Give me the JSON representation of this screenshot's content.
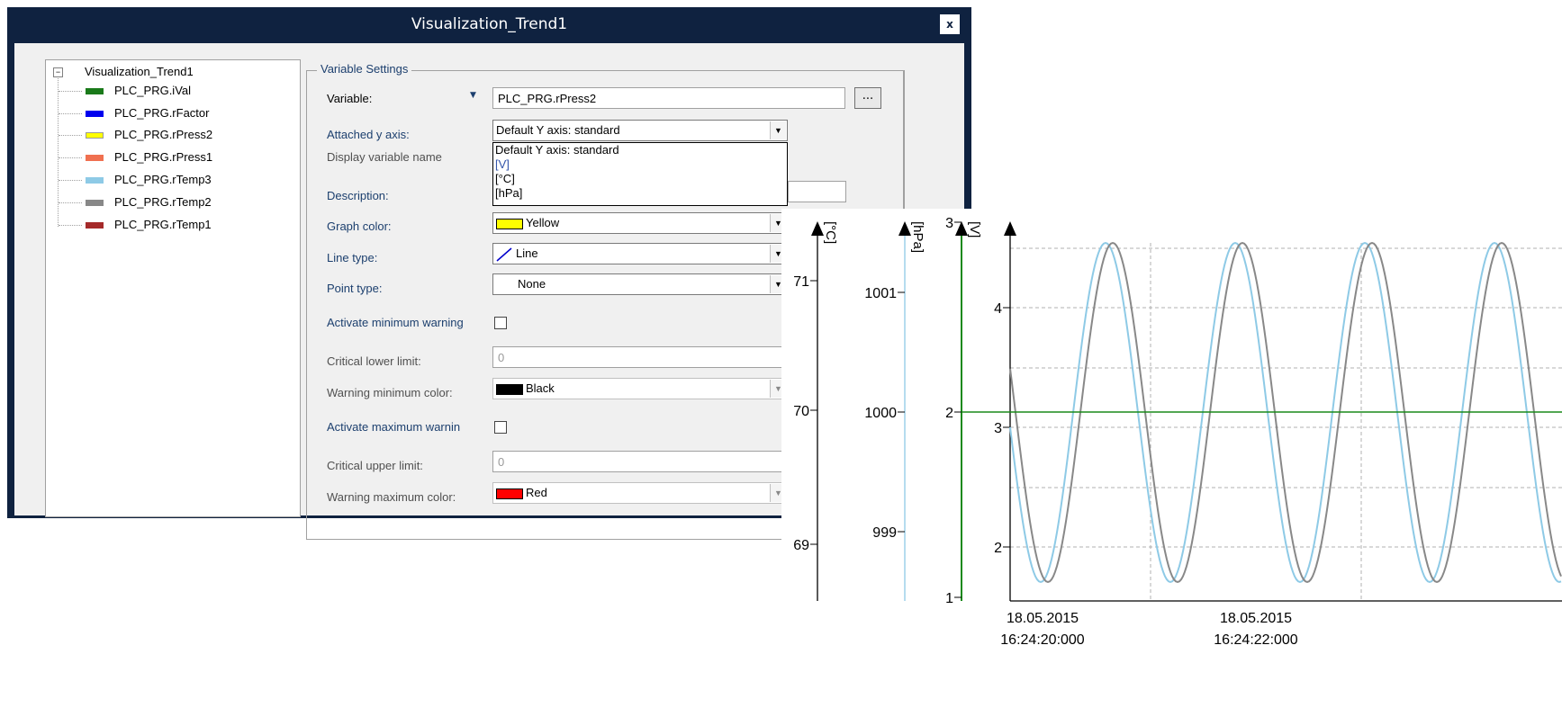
{
  "dialog": {
    "title": "Visualization_Trend1",
    "close_label": "x"
  },
  "tree": {
    "root": "Visualization_Trend1",
    "expander": "⊟",
    "items": [
      {
        "label": "PLC_PRG.iVal",
        "color": "#1a7a1a"
      },
      {
        "label": "PLC_PRG.rFactor",
        "color": "#0000ee"
      },
      {
        "label": "PLC_PRG.rPress2",
        "color": "#ffff00"
      },
      {
        "label": "PLC_PRG.rPress1",
        "color": "#f07050"
      },
      {
        "label": "PLC_PRG.rTemp3",
        "color": "#8ecae6"
      },
      {
        "label": "PLC_PRG.rTemp2",
        "color": "#888888"
      },
      {
        "label": "PLC_PRG.rTemp1",
        "color": "#a52a2a"
      }
    ]
  },
  "settings": {
    "group_title": "Variable Settings",
    "variable_label": "Variable:",
    "variable_value": "PLC_PRG.rPress2",
    "browse_label": "...",
    "y_axis_label": "Attached y axis:",
    "y_axis_value": "Default Y axis: standard",
    "y_axis_options": [
      "Default Y axis: standard",
      "[V]",
      "[°C]",
      "[hPa]"
    ],
    "display_name_label": "Display variable name",
    "description_label": "Description:",
    "graph_color_label": "Graph color:",
    "graph_color_value": "Yellow",
    "graph_color_swatch": "#ffff00",
    "line_type_label": "Line type:",
    "line_type_value": "Line",
    "point_type_label": "Point type:",
    "point_type_value": "None",
    "min_warning_label": "Activate minimum warning",
    "critical_lower_label": "Critical lower limit:",
    "critical_lower_value": "0",
    "warn_min_color_label": "Warning minimum color:",
    "warn_min_color_value": "Black",
    "warn_min_color_swatch": "#000000",
    "max_warning_label": "Activate maximum warnin",
    "critical_upper_label": "Critical upper limit:",
    "critical_upper_value": "0",
    "warn_max_color_label": "Warning maximum color:",
    "warn_max_color_value": "Red",
    "warn_max_color_swatch": "#ff0000"
  },
  "chart_data": {
    "type": "line",
    "y_axes": [
      {
        "label": "[°C]",
        "ticks": [
          "71",
          "70",
          "69"
        ],
        "color": "#000000"
      },
      {
        "label": "[hPa]",
        "ticks": [
          "1001",
          "1000",
          "999"
        ],
        "color": "#8ecae6"
      },
      {
        "label": "[V]",
        "ticks": [
          "3",
          "2",
          "1"
        ],
        "color": "#1a8a1a"
      },
      {
        "label": "",
        "ticks": [
          "4",
          "3",
          "2"
        ],
        "color": "#000000"
      }
    ],
    "x_ticks": [
      {
        "date": "18.05.2015",
        "time": "16:24:20:000"
      },
      {
        "date": "18.05.2015",
        "time": "16:24:22:000"
      }
    ],
    "series": [
      {
        "color": "#8ecae6",
        "shape": "sine"
      },
      {
        "color": "#888888",
        "shape": "sine"
      },
      {
        "color": "#1a8a1a",
        "shape": "constant",
        "value": 2
      }
    ]
  }
}
